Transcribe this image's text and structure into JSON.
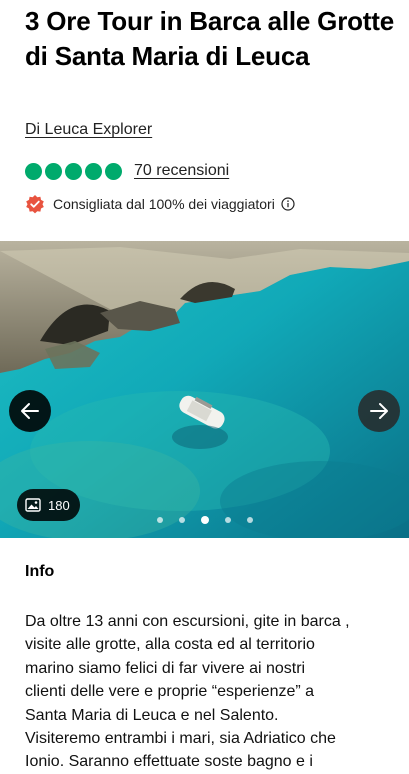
{
  "header": {
    "title": "3 Ore Tour in Barca alle Grotte di Santa Maria di Leuca",
    "operator": "Di Leuca Explorer"
  },
  "rating": {
    "bubbles_filled": 5,
    "bubbles_total": 5,
    "reviews_label": "70 recensioni",
    "accent_color": "#00aa6c"
  },
  "recommendation": {
    "text": "Consigliata dal 100% dei viaggiatori",
    "badge_color": "#e8533f"
  },
  "gallery": {
    "photo_count": "180",
    "dots_total": 5,
    "active_dot": 3
  },
  "info": {
    "heading": "Info",
    "body": "Da oltre 13 anni con escursioni, gite in barca ,\nvisite alle grotte, alla costa ed al territorio\nmarino siamo felici di far vivere ai nostri\nclienti delle vere e proprie “esperienze” a\nSanta Maria di Leuca e nel Salento.\n Visiteremo entrambi i mari, sia Adriatico che\nIonio. Saranno effettuate soste bagno e i"
  }
}
